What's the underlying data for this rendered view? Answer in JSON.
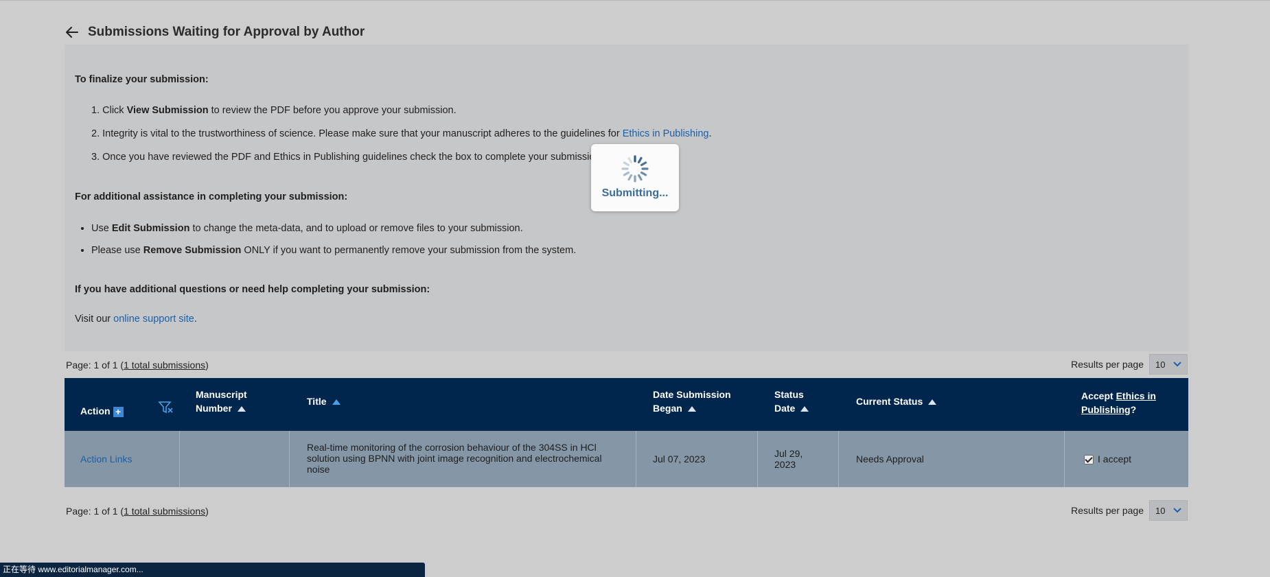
{
  "header": {
    "title": "Submissions Waiting for Approval by Author"
  },
  "instructions": {
    "finalize_heading": "To finalize your submission:",
    "step1": {
      "num": "1.",
      "pre": "Click ",
      "bold": "View Submission",
      "post": " to review the PDF before you approve your submission."
    },
    "step2": {
      "num": "2.",
      "pre": "Integrity is vital to the trustworthiness of science. Please make sure that your manuscript adheres to the guidelines for ",
      "link": "Ethics in Publishing",
      "post": "."
    },
    "step3": {
      "num": "3.",
      "text": "Once you have reviewed the PDF and Ethics in Publishing guidelines check the box to complete your submission."
    },
    "assist_heading": "For additional assistance in completing your submission:",
    "bullet1": {
      "pre": "Use ",
      "bold": "Edit Submission",
      "post": " to change the meta-data, and to upload or remove files to your submission."
    },
    "bullet2": {
      "pre": "Please use ",
      "bold": "Remove Submission",
      "post": " ONLY if you want to permanently remove your submission from the system."
    },
    "help_heading": "If you have additional questions or need help completing your submission:",
    "visit_pre": "Visit our ",
    "visit_link": "online support site",
    "visit_post": "."
  },
  "loading": {
    "text": "Submitting..."
  },
  "pager": {
    "pre": "Page: 1 of 1 (",
    "link": "1 total submissions",
    "post": ")",
    "results_label": "Results per page",
    "results_value": "10"
  },
  "table": {
    "columns": {
      "action": "Action",
      "manuscript_1": "Manuscript",
      "manuscript_2": "Number",
      "title": "Title",
      "date_began_1": "Date Submission",
      "date_began_2": "Began",
      "status_date_1": "Status",
      "status_date_2": "Date",
      "current_status": "Current Status",
      "accept_pre": "Accept ",
      "accept_link_1": "Ethics in",
      "accept_link_2": "Publishing",
      "accept_post": "?"
    },
    "rows": [
      {
        "action": "Action Links",
        "manuscript_number": "",
        "title": "Real-time monitoring of the corrosion behaviour of the 304SS in HCl solution using BPNN with joint image recognition and electrochemical noise",
        "date_began": "Jul 07, 2023",
        "status_date_1": "Jul 29,",
        "status_date_2": "2023",
        "current_status": "Needs Approval",
        "accept_label": "I accept",
        "accepted": true
      }
    ]
  },
  "statusbar": {
    "text": "正在等待 www.editorialmanager.com..."
  }
}
